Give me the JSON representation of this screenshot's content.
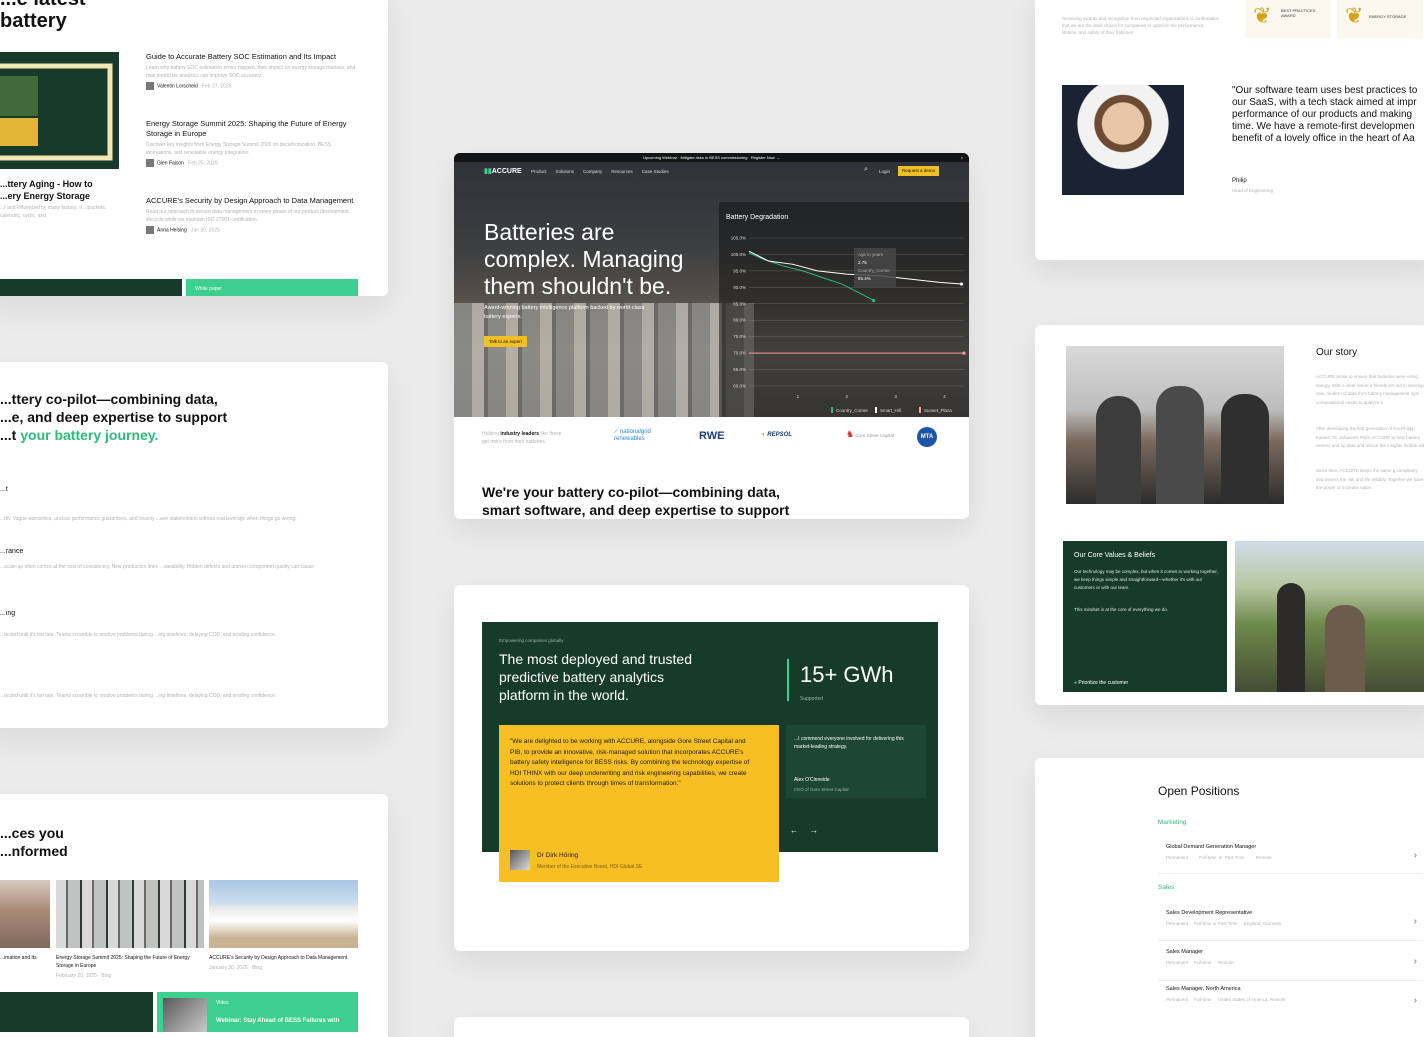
{
  "blog": {
    "heading_line1": "...e latest",
    "heading_line2": "battery",
    "articles": [
      {
        "title": "Guide to Accurate Battery SOC Estimation and Its Impact",
        "excerpt": "Learn why battery SOC estimation errors happen, their impact on energy storage markets, and how predictive analytics can improve SOC accuracy.",
        "author": "Valentin Lorscheid",
        "date": "Feb 27, 2025"
      },
      {
        "title": "Energy Storage Summit 2025: Shaping the Future of Energy Storage in Europe",
        "excerpt": "Discover key insights from Energy Storage Summit 2025 on decarbonization, BESS innovations, and renewable energy integration.",
        "author": "Gien Faison",
        "date": "Feb 25, 2025"
      },
      {
        "title": "ACCURE's Security by Design Approach to Data Management",
        "excerpt": "Read our approach to secure data management in every phase of our product development lifecycle while we maintain ISO 27001 certification.",
        "author": "Anna Helsing",
        "date": "Jan 30, 2025"
      }
    ],
    "left_article_title": "...ttery Aging - How to ...ery Energy Storage",
    "left_article_excerpt": "...r and influenced by many factors. It ...buckets: calendric, cyclic, and",
    "whitepaper_label": "White paper"
  },
  "copilot": {
    "line1": "...ttery co-pilot—combining data,",
    "line2": "...e, and deep expertise to support",
    "line3_dark": "...t ",
    "line3_green": "your battery journey.",
    "items": [
      {
        "title": "...t",
        "text": "...rth. Vague warranties, unclear performance guarantees, and loosely ...ave stakeholders without real leverage when things go wrong."
      },
      {
        "title": "...rance",
        "text": "...scale-up often comes at the cost of consistency. New production lines ...variability. Hidden defects and uneven component quality can cause"
      },
      {
        "title": "...ing",
        "text": "...tected until it's too late. Teams scramble to resolve problems during ...ing timelines, delaying COD, and eroding confidence."
      },
      {
        "title": "",
        "text": "...tected until it's too late. Teams scramble to resolve problems during ...ing timelines, delaying COD, and eroding confidence."
      }
    ]
  },
  "resources": {
    "heading_line1": "...ces you",
    "heading_line2": "...nformed",
    "items": [
      {
        "title": "...imation and Its",
        "meta": ""
      },
      {
        "title": "Energy Storage Summit 2025: Shaping the Future of Energy Storage in Europe",
        "meta": "February 20, 2025 · Blog"
      },
      {
        "title": "ACCURE's Security by Design Approach to Data Management",
        "meta": "January 30, 2025 · Blog"
      }
    ],
    "video_tag": "Video",
    "video_title": "Webinar: Stay Ahead of BESS Failures with"
  },
  "hero": {
    "banner": "Upcoming Webinar · Mitigate risks in BESS commissioning",
    "banner_cta": "Register Now →",
    "logo": "ACCURE",
    "nav": [
      "Product",
      "Solutions",
      "Company",
      "Resources",
      "Case Studies"
    ],
    "login": "Login",
    "demo": "Request a demo",
    "headline": [
      "Batteries are",
      "complex. Managing",
      "them shouldn't be."
    ],
    "sub": "Award-winning battery intelligence platform backed by world-class battery experts.",
    "cta": "Talk to an expert",
    "trusted_prefix": "Helping ",
    "trusted_bold": "industry leaders",
    "trusted_suffix": " like these get more from their batteries.",
    "partners": [
      "nationalgrid renewables",
      "RWE",
      "REPSOL",
      "Gore Street Capital",
      "MTA"
    ],
    "copilot_line1": "We're your battery co-pilot—combining data,",
    "copilot_line2": "smart software, and deep expertise to support"
  },
  "chart_data": {
    "type": "line",
    "title": "Battery Degradation",
    "y_ticks": [
      "105.0%",
      "100.0%",
      "95.0%",
      "90.0%",
      "85.0%",
      "80.0%",
      "75.0%",
      "70.0%",
      "65.0%",
      "60.0%"
    ],
    "x_ticks": [
      "1",
      "2",
      "3",
      "4"
    ],
    "ylim": [
      60,
      105
    ],
    "xlim": [
      0,
      4.4
    ],
    "series": [
      {
        "name": "Country_Corner",
        "color": "#2dbb7a",
        "x": [
          0,
          0.3,
          0.7,
          1.1,
          1.5,
          1.9,
          2.3,
          2.55
        ],
        "y": [
          100.5,
          98.5,
          96.5,
          95,
          93,
          91,
          88,
          86
        ]
      },
      {
        "name": "Smart_Hill",
        "color": "#ffffff",
        "x": [
          0,
          0.4,
          0.9,
          1.4,
          2.0,
          2.7,
          3.3,
          3.9,
          4.35
        ],
        "y": [
          101,
          98,
          97,
          95,
          94,
          93.5,
          92.5,
          91.5,
          91
        ]
      },
      {
        "name": "Sunset_Plaza",
        "color": "#ff9a9a",
        "x": [
          0,
          4.4
        ],
        "y": [
          70,
          70
        ]
      }
    ],
    "tooltip": {
      "label1": "Age in years",
      "value1": "2.75",
      "label2": "Country_Corner",
      "value2": "85.4%"
    }
  },
  "stats": {
    "eyebrow": "Empowering companies globally",
    "heading": [
      "The most deployed and trusted",
      "predictive battery analytics",
      "platform in the world."
    ],
    "big": "15+ GWh",
    "big_label": "Supported",
    "quote": "\"We are delighted to be working with ACCURE, alongside Gore Street Capital and PIB, to provide an innovative, risk-managed solution that incorporates ACCURE's battery safety intelligence for BESS risks. By combining the technology expertise of HDI THINX with our deep underwriting and risk engineering capabilities, we create solutions to protect clients through times of transformation.\"",
    "quote_author": "Dr Dirk Höring",
    "quote_role": "Member of the Executive Board, HDI Global SE",
    "quote2": "...I commend everyone involved for delivering this market-leading strategy.",
    "quote2_author": "Alex O'Cinneide",
    "quote2_role": "CEO of Gore Street Capital",
    "prev": "←",
    "next": "→"
  },
  "testimonial": {
    "top_text": "Receiving awards and recognition from respected organizations is confirmation that we are the ideal choice for companies to optimize the performance, lifetime, and safety of their batteries.",
    "award1": "BEST PRACTICES AWARD",
    "award2": "ENERGY STORAGE",
    "quote_lines": [
      "\"Our software team uses best practices to",
      "our SaaS, with a tech stack aimed at impr",
      "performance of our products and making",
      "time. We have a remote-first developmen",
      "benefit of a lovely office in the heart of Aa"
    ],
    "name": "Philip",
    "role": "Head of Engineering"
  },
  "story": {
    "title": "Our story",
    "paragraphs": [
      "ACCURE arose to ensure that batteries were using energy. With a clear vision a friends set out to develop new, modern of data from battery management syst computational needs to analyze it.",
      "After developing the first generation of Kai-Philipp Kairies, Dr. Johannes Palm ACCURE to help battery owners and op data and unlock the insights hidden wit",
      "Since then, ACCURE keeps the same g complexity and assess the risk and life reliably. Together we have the power of increase value."
    ],
    "values_title": "Our Core Values & Beliefs",
    "values_text": "Our technology may be complex, but when it comes to working together, we keep things simple and straightforward—whether it's with our customers or with our team.",
    "values_text2": "This mindset is at the core of everything we do.",
    "values_item": "Prioritize the customer"
  },
  "jobs": {
    "title": "Open Positions",
    "groups": [
      {
        "name": "Marketing",
        "roles": [
          {
            "title": "Global Demand Generation Manager",
            "meta": [
              "Permanent",
              "Full-time or Part-Time",
              "Remote"
            ]
          }
        ]
      },
      {
        "name": "Sales",
        "roles": [
          {
            "title": "Sales Development Representative",
            "meta": [
              "Permanent",
              "Full-time or Part-Time",
              "England, Germany"
            ]
          },
          {
            "title": "Sales Manager",
            "meta": [
              "Permanent",
              "Full-time",
              "Remote"
            ]
          },
          {
            "title": "Sales Manager, North America",
            "meta": [
              "Permanent",
              "Full-time",
              "United States of America, Remote"
            ]
          }
        ]
      }
    ]
  }
}
